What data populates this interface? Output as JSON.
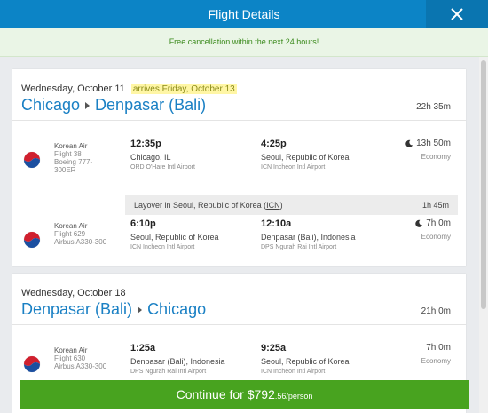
{
  "header": {
    "title": "Flight Details"
  },
  "notice": {
    "text": "Free cancellation within the next 24 hours!"
  },
  "outbound": {
    "date": "Wednesday, October 11",
    "arrives": "arrives Friday, October 13",
    "origin": "Chicago",
    "destination": "Denpasar (Bali)",
    "duration": "22h 35m",
    "segments": [
      {
        "airline": "Korean Air",
        "flight": "Flight 38",
        "aircraft": "Boeing 777-300ER",
        "dep_time": "12:35p",
        "dep_city": "Chicago, IL",
        "dep_airport": "ORD O'Hare Intl Airport",
        "arr_time": "4:25p",
        "arr_city": "Seoul, Republic of Korea",
        "arr_airport": "ICN Incheon Intl Airport",
        "duration": "13h 50m",
        "cabin": "Economy"
      },
      {
        "airline": "Korean Air",
        "flight": "Flight 629",
        "aircraft": "Airbus A330-300",
        "dep_time": "6:10p",
        "dep_city": "Seoul, Republic of Korea",
        "dep_airport": "ICN Incheon Intl Airport",
        "arr_time": "12:10a",
        "arr_city": "Denpasar (Bali), Indonesia",
        "arr_airport": "DPS Ngurah Rai Intl Airport",
        "duration": "7h 0m",
        "cabin": "Economy"
      }
    ],
    "layover": {
      "prefix": "Layover in Seoul, Republic of Korea (",
      "code": "ICN",
      "suffix": ")",
      "duration": "1h 45m"
    }
  },
  "return": {
    "date": "Wednesday, October 18",
    "origin": "Denpasar (Bali)",
    "destination": "Chicago",
    "duration": "21h 0m",
    "segments": [
      {
        "airline": "Korean Air",
        "flight": "Flight 630",
        "aircraft": "Airbus A330-300",
        "dep_time": "1:25a",
        "dep_city": "Denpasar (Bali), Indonesia",
        "dep_airport": "DPS Ngurah Rai Intl Airport",
        "arr_time": "9:25a",
        "arr_city": "Seoul, Republic of Korea",
        "arr_airport": "ICN Incheon Intl Airport",
        "duration": "7h 0m",
        "cabin": "Economy"
      }
    ]
  },
  "continue": {
    "label": "Continue for $792",
    "cents": ".56/person"
  },
  "colors": {
    "header": "#0c84c6",
    "accent": "#1a80c4",
    "continue": "#48a31f",
    "notice": "#3b8a1c"
  },
  "icons": {
    "close": "close-icon",
    "moon": "moon-icon",
    "logo": "korean-air-logo-icon"
  }
}
